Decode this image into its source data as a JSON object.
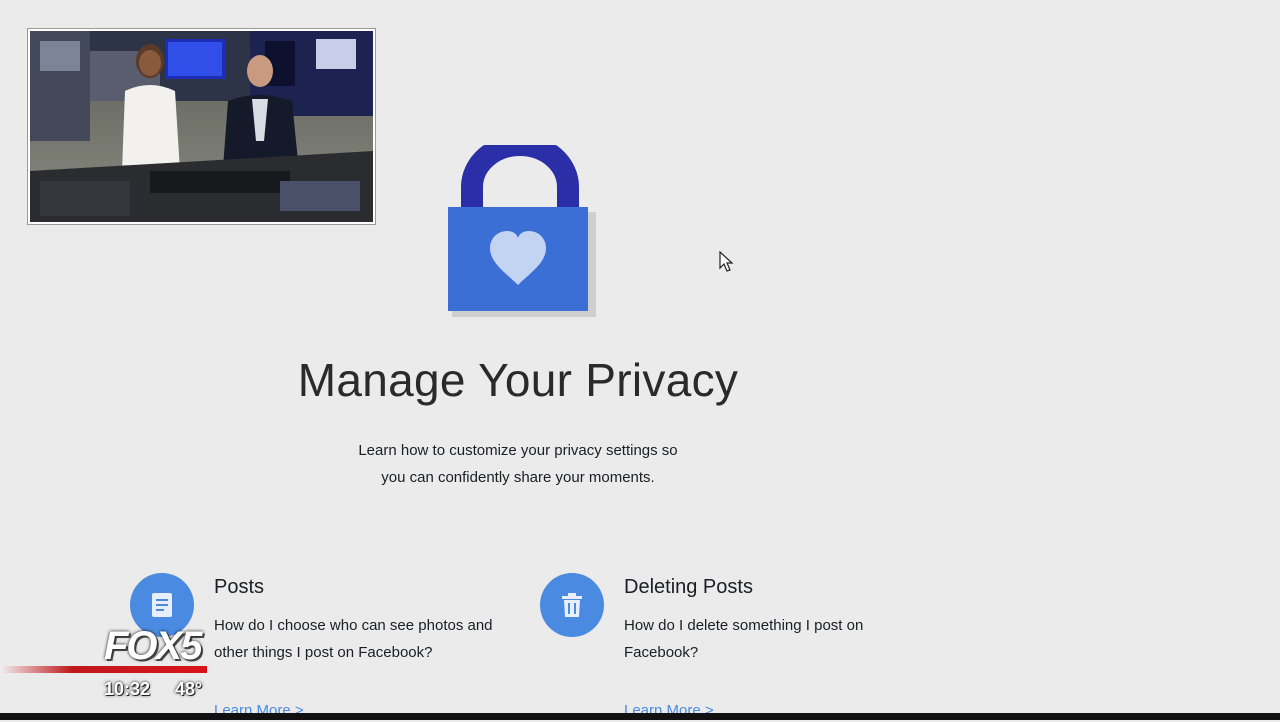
{
  "hero": {
    "title": "Manage Your Privacy",
    "subtitle_line1": "Learn how to customize your privacy settings so",
    "subtitle_line2": "you can confidently share your moments.",
    "icon": "padlock-heart-icon"
  },
  "topics": [
    {
      "icon": "document-icon",
      "heading": "Posts",
      "desc_line1": "How do I choose who can see photos and",
      "desc_line2": "other things I post on Facebook?",
      "link": "Learn More >"
    },
    {
      "icon": "trash-icon",
      "heading": "Deleting Posts",
      "desc_line1": "How do I delete something I post on",
      "desc_line2": "Facebook?",
      "link": "Learn More >"
    }
  ],
  "broadcast": {
    "station": "FOX5",
    "time": "10:32",
    "temperature": "48°",
    "accent_color": "#d8141a"
  },
  "colors": {
    "background": "#ebebeb",
    "accent_blue": "#4a8ae0",
    "lock_body": "#3b6fd6",
    "lock_shackle": "#2a2fa8"
  }
}
